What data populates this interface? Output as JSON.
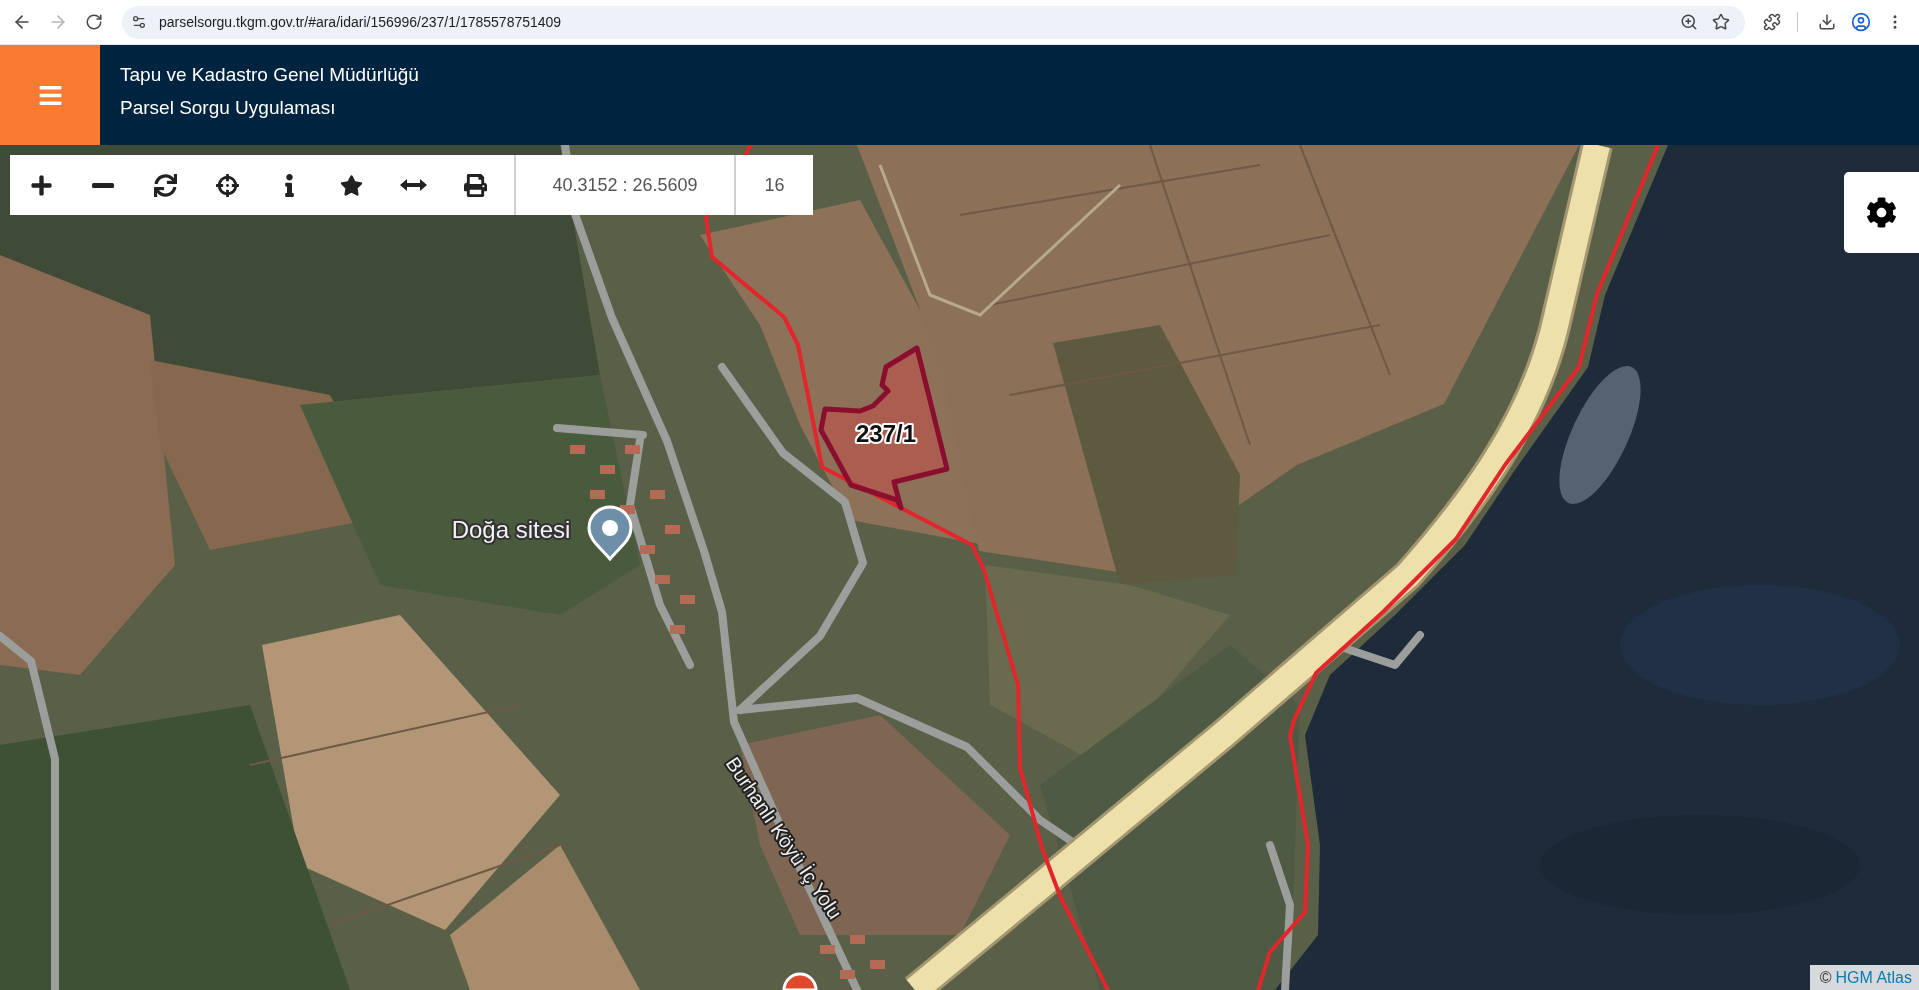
{
  "browser": {
    "url": "parselsorgu.tkgm.gov.tr/#ara/idari/156996/237/1/1785578751409",
    "forward_disabled": true
  },
  "header": {
    "title": "Tapu ve Kadastro Genel Müdürlüğü",
    "subtitle": "Parsel Sorgu Uygulaması"
  },
  "toolbar": {
    "coordinates": "40.3152 : 26.5609",
    "zoom_level": "16"
  },
  "map": {
    "parcel_label": "237/1",
    "place_label": "Doğa sitesi",
    "road_label": "Burhanlı Köyü İç Yolu"
  },
  "attribution": {
    "symbol": "©",
    "link": "HGM Atlas"
  }
}
